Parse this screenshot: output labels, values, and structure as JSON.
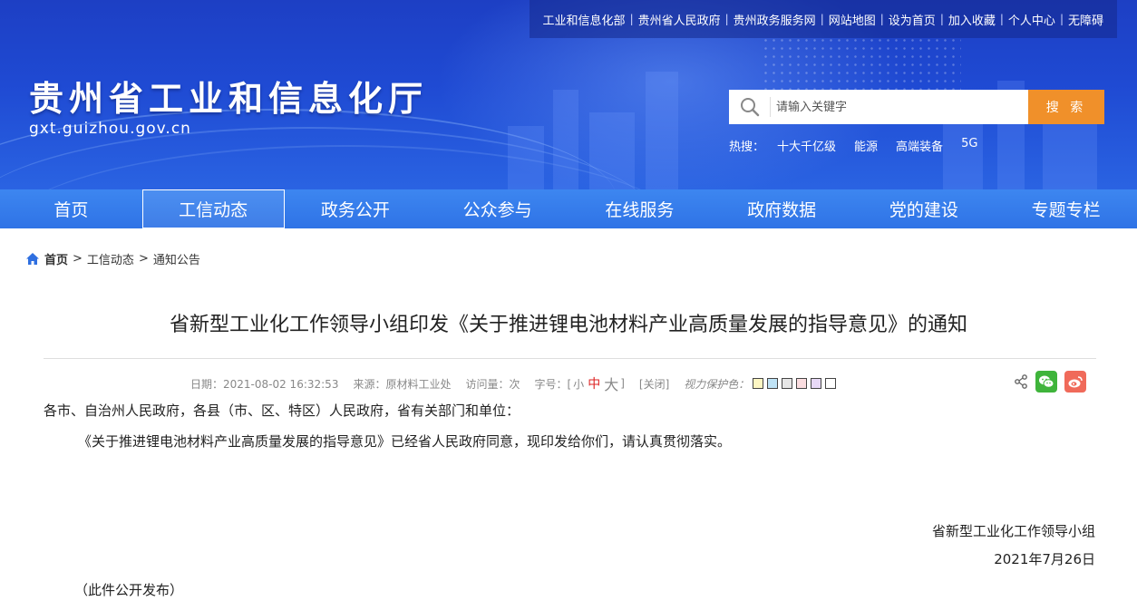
{
  "header": {
    "top_links": [
      "工业和信息化部",
      "贵州省人民政府",
      "贵州政务服务网",
      "网站地图",
      "设为首页",
      "加入收藏",
      "个人中心",
      "无障碍"
    ],
    "brand_cn": "贵州省工业和信息化厅",
    "brand_en": "gxt.guizhou.gov.cn",
    "search_placeholder": "请输入关键字",
    "search_button": "搜 索",
    "hot_label": "热搜：",
    "hot_terms": [
      "十大千亿级",
      "能源",
      "高端装备",
      "5G"
    ]
  },
  "nav": {
    "items": [
      "首页",
      "工信动态",
      "政务公开",
      "公众参与",
      "在线服务",
      "政府数据",
      "党的建设",
      "专题专栏"
    ],
    "active": "工信动态"
  },
  "breadcrumb": {
    "home": "首页",
    "sep": ">",
    "level1": "工信动态",
    "level2": "通知公告"
  },
  "article": {
    "title": "省新型工业化工作领导小组印发《关于推进锂电池材料产业高质量发展的指导意见》的通知",
    "date": "日期：2021-08-02 16:32:53",
    "source": "来源：原材料工业处",
    "visits": "访问量：次",
    "font_label": "字号：[",
    "font_small": "小",
    "font_medium": "中",
    "font_large": "大",
    "font_close": "]",
    "close": "[关闭]",
    "eye_label": "视力保护色：",
    "swatches": [
      "#fdf6c3",
      "#bfe3f6",
      "#e6e6e6",
      "#fbdde0",
      "#e8d9f7",
      "#ffffff"
    ],
    "para1": "各市、自治州人民政府，各县（市、区、特区）人民政府，省有关部门和单位：",
    "para2": "《关于推进锂电池材料产业高质量发展的指导意见》已经省人民政府同意，现印发给你们，请认真贯彻落实。",
    "signature": "省新型工业化工作领导小组",
    "sign_date": "2021年7月26日",
    "note": "（此件公开发布）"
  },
  "colors": {
    "header_blue": "#1f4ad3",
    "nav_blue": "#3d86f0",
    "search_orange": "#f0902a",
    "wechat_green": "#3fb43b",
    "weibo_red": "#f06a5a"
  },
  "icons": [
    "search-icon",
    "home-icon",
    "share-icon",
    "wechat-icon",
    "weibo-icon"
  ]
}
